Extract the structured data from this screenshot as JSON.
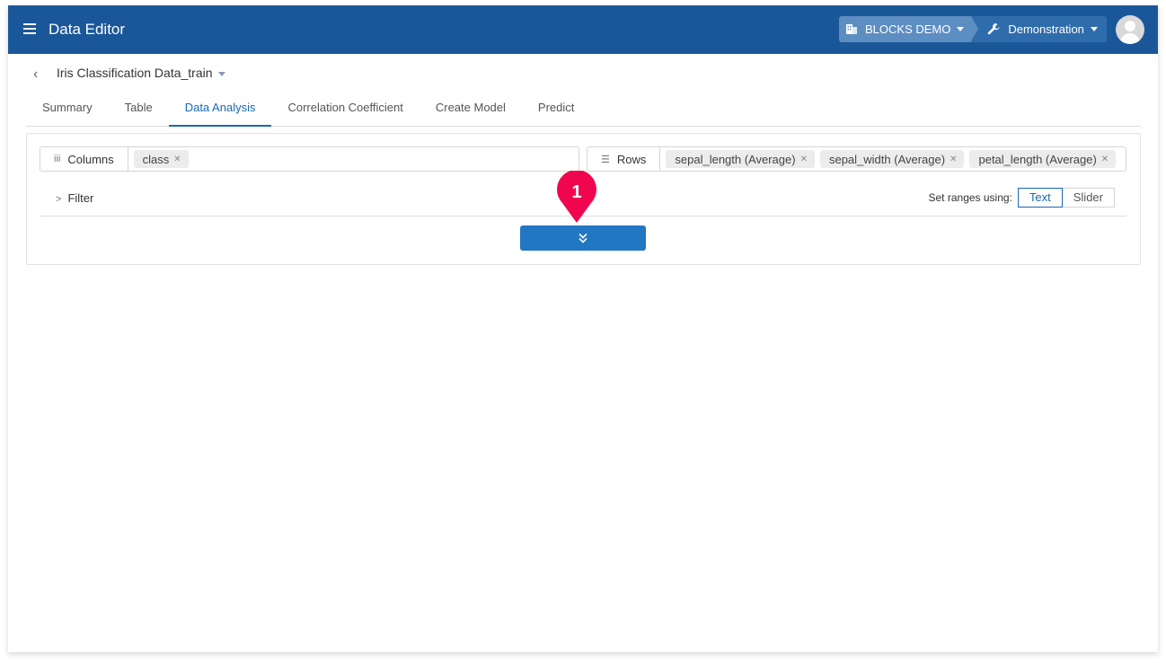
{
  "header": {
    "app_title": "Data Editor",
    "organization": "BLOCKS DEMO",
    "project": "Demonstration",
    "colors": {
      "header_bg": "#1a5799",
      "accent": "#1a68b3",
      "marker": "#f0064f"
    }
  },
  "dataset": {
    "name": "Iris Classification Data_train"
  },
  "tabs": [
    {
      "label": "Summary"
    },
    {
      "label": "Table"
    },
    {
      "label": "Data Analysis",
      "active": true
    },
    {
      "label": "Correlation Coefficient"
    },
    {
      "label": "Create Model"
    },
    {
      "label": "Predict"
    }
  ],
  "pivot": {
    "columns_label": "Columns",
    "columns": [
      "class"
    ],
    "rows_label": "Rows",
    "rows": [
      "sepal_length (Average)",
      "sepal_width (Average)",
      "petal_length (Average)"
    ],
    "filter_label": "Filter",
    "ranges_label": "Set ranges using:",
    "range_options": [
      "Text",
      "Slider"
    ],
    "range_selected": "Text",
    "expand_icon": "double-chevron-down"
  },
  "annotation": {
    "step": "1"
  }
}
